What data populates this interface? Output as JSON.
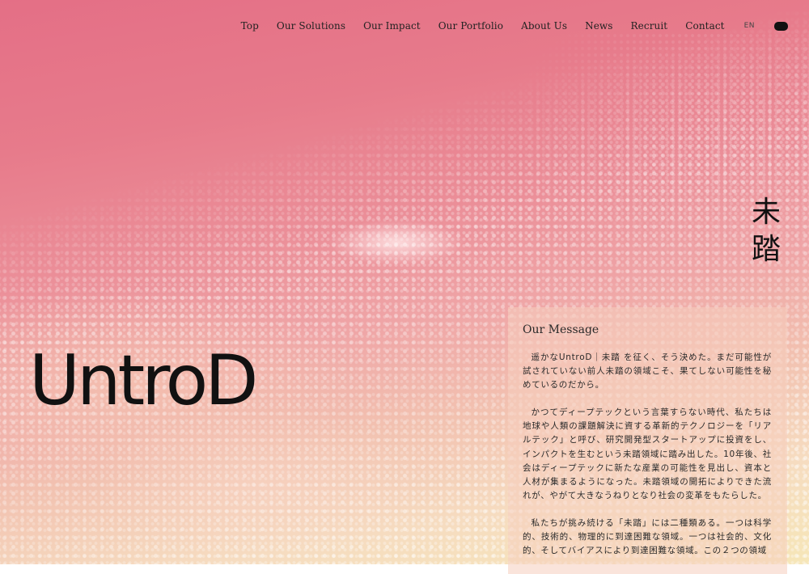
{
  "nav": {
    "items": [
      "Top",
      "Our Solutions",
      "Our Impact",
      "Our Portfolio",
      "About Us",
      "News",
      "Recruit",
      "Contact"
    ],
    "lang": "EN"
  },
  "hero": {
    "logo": "UntroD",
    "vertical_title": [
      "未",
      "踏"
    ]
  },
  "message": {
    "heading": "Our Message",
    "paragraphs": [
      "遥かなUntroD｜未踏 を征く、そう決めた。まだ可能性が試されていない前人未踏の領域こそ、果てしない可能性を秘めているのだから。",
      "かつてディープテックという言葉すらない時代、私たちは地球や人類の課題解決に資する革新的テクノロジーを「リアルテック」と呼び、研究開発型スタートアップに投資をし、インパクトを生むという未踏領域に踏み出した。10年後、社会はディープテックに新たな産業の可能性を見出し、資本と人材が集まるようになった。未踏領域の開拓によりできた流れが、やがて大きなうねりとなり社会の変革をもたらした。",
      "私たちが挑み続ける「未踏」には二種類ある。一つは科学的、技術的、物理的に到達困難な領域。一つは社会的、文化的、そしてバイアスにより到達困難な領域。この２つの領域"
    ]
  }
}
